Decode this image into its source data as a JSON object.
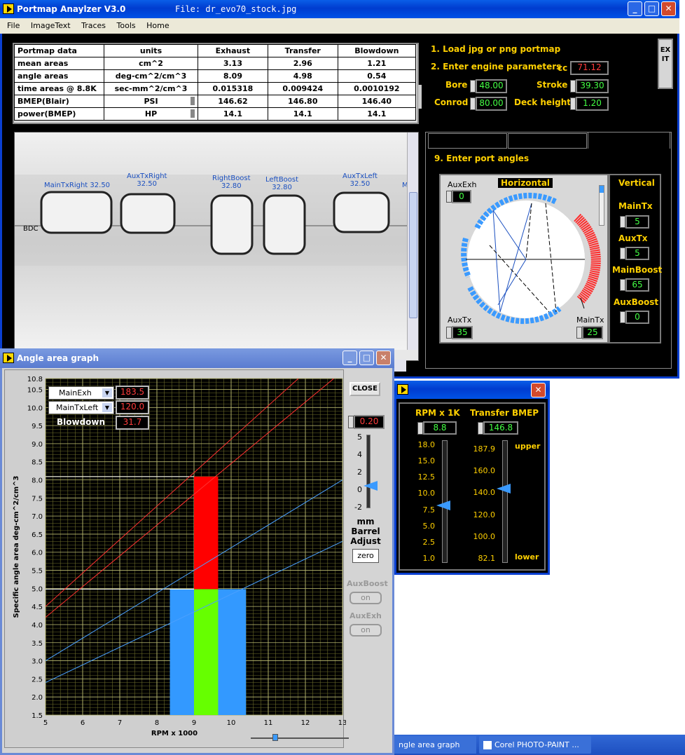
{
  "main": {
    "title": "Portmap Anaylzer V3.0",
    "file": "File: dr_evo70_stock.jpg",
    "menu": [
      "File",
      "ImageText",
      "Traces",
      "Tools",
      "Home"
    ],
    "table": {
      "headers": [
        "Portmap data",
        "units",
        "Exhaust",
        "Transfer",
        "Blowdown"
      ],
      "rows": [
        [
          "mean areas",
          "cm^2",
          "3.13",
          "2.96",
          "1.21"
        ],
        [
          "angle areas",
          "deg-cm^2/cm^3",
          "8.09",
          "4.98",
          "0.54"
        ],
        [
          "time areas @ 8.8K",
          "sec-mm^2/cm^3",
          "0.015318",
          "0.009424",
          "0.0010192"
        ],
        [
          "BMEP(Blair)",
          "PSI",
          "146.62",
          "146.80",
          "146.40"
        ],
        [
          "power(BMEP)",
          "HP",
          "14.1",
          "14.1",
          "14.1"
        ]
      ]
    },
    "steps": {
      "step1": "1. Load jpg or png portmap",
      "step2": "2. Enter engine parameters",
      "cc_label": "cc",
      "cc": "71.12",
      "bore_label": "Bore",
      "bore": "48.00",
      "stroke_label": "Stroke",
      "stroke": "39.30",
      "conrod_label": "Conrod",
      "conrod": "80.00",
      "deck_label": "Deck height",
      "deck": "1.20",
      "step9": "9. Enter port angles"
    },
    "exit": "EXIT",
    "ports": {
      "bdc": "BDC",
      "labels": [
        {
          "name": "MainTxRight 32.50"
        },
        {
          "name": "AuxTxRight",
          "val": "32.50"
        },
        {
          "name": "RightBoost",
          "val": "32.80"
        },
        {
          "name": "LeftBoost",
          "val": "32.80"
        },
        {
          "name": "AuxTxLeft",
          "val": "32.50"
        },
        {
          "name": "M"
        }
      ]
    },
    "angles": {
      "auxexh_label": "AuxExh",
      "auxexh": "0",
      "horizontal": "Horizontal",
      "auxtx_label": "AuxTx",
      "auxtx": "35",
      "maintx_label": "MainTx",
      "maintx": "25",
      "vertical": "Vertical",
      "v_maintx_label": "MainTx",
      "v_maintx": "5",
      "v_auxtx_label": "AuxTx",
      "v_auxtx": "5",
      "v_mainboost_label": "MainBoost",
      "v_mainboost": "65",
      "v_auxboost_label": "AuxBoost",
      "v_auxboost": "0"
    }
  },
  "rpm": {
    "rpm_label": "RPM x 1K",
    "rpm": "8.8",
    "bmep_label": "Transfer BMEP",
    "bmep": "146.8",
    "rpm_ticks": [
      "18.0",
      "15.0",
      "12.5",
      "10.0",
      "7.5",
      "5.0",
      "2.5",
      "1.0"
    ],
    "bmep_ticks": [
      "187.9",
      "160.0",
      "140.0",
      "120.0",
      "100.0",
      "82.1"
    ],
    "upper": "upper",
    "lower": "lower"
  },
  "graph": {
    "title": "Angle area graph",
    "sel1": "MainExh",
    "val1": "183.5",
    "sel2": "MainTxLeft",
    "val2": "120.0",
    "blowdown_label": "Blowdown",
    "blowdown": "31.7",
    "close": "CLOSE",
    "adj": "0.20",
    "adj_ticks": [
      "5",
      "4",
      "2",
      "0",
      "-2"
    ],
    "mm": "mm",
    "barrel": "Barrel",
    "adjust": "Adjust",
    "zero": "zero",
    "auxboost": "AuxBoost",
    "auxexh": "AuxExh",
    "on": "on"
  },
  "taskbar": {
    "item1": "ngle area graph",
    "item2": "Corel PHOTO-PAINT ..."
  },
  "chart_data": {
    "type": "bar",
    "xlabel": "RPM x 1000",
    "ylabel": "Specific angle area  deg-cm^2/cm^3",
    "xlim": [
      5,
      13
    ],
    "ylim": [
      1.5,
      10.8
    ],
    "x_ticks": [
      5,
      6,
      7,
      8,
      9,
      10,
      11,
      12,
      13
    ],
    "y_ticks": [
      1.5,
      2.0,
      2.5,
      3.0,
      3.5,
      4.0,
      4.5,
      5.0,
      5.5,
      6.0,
      6.5,
      7.0,
      7.5,
      8.0,
      8.5,
      9.0,
      9.5,
      10.0,
      10.5,
      10.8
    ],
    "bars": [
      {
        "name": "blue",
        "x0": 8.35,
        "x1": 10.4,
        "y": 4.98,
        "color": "#3399ff"
      },
      {
        "name": "green",
        "x0": 9.0,
        "x1": 9.65,
        "y": 4.98,
        "color": "#66ff00"
      },
      {
        "name": "red",
        "x0": 9.0,
        "x1": 9.65,
        "y0": 4.98,
        "y": 8.09,
        "color": "#ff0000"
      }
    ],
    "lines": [
      {
        "x": [
          5,
          13
        ],
        "y": [
          4.5,
          11.9
        ],
        "color": "#ff3030"
      },
      {
        "x": [
          5,
          13
        ],
        "y": [
          4.2,
          11.0
        ],
        "color": "#ff3030"
      },
      {
        "x": [
          5,
          13
        ],
        "y": [
          3.0,
          8.0
        ],
        "color": "#4aa0ff"
      },
      {
        "x": [
          5,
          13
        ],
        "y": [
          2.4,
          6.3
        ],
        "color": "#4aa0ff"
      }
    ],
    "hlines": [
      {
        "y": 8.09
      },
      {
        "y": 4.98
      }
    ]
  }
}
